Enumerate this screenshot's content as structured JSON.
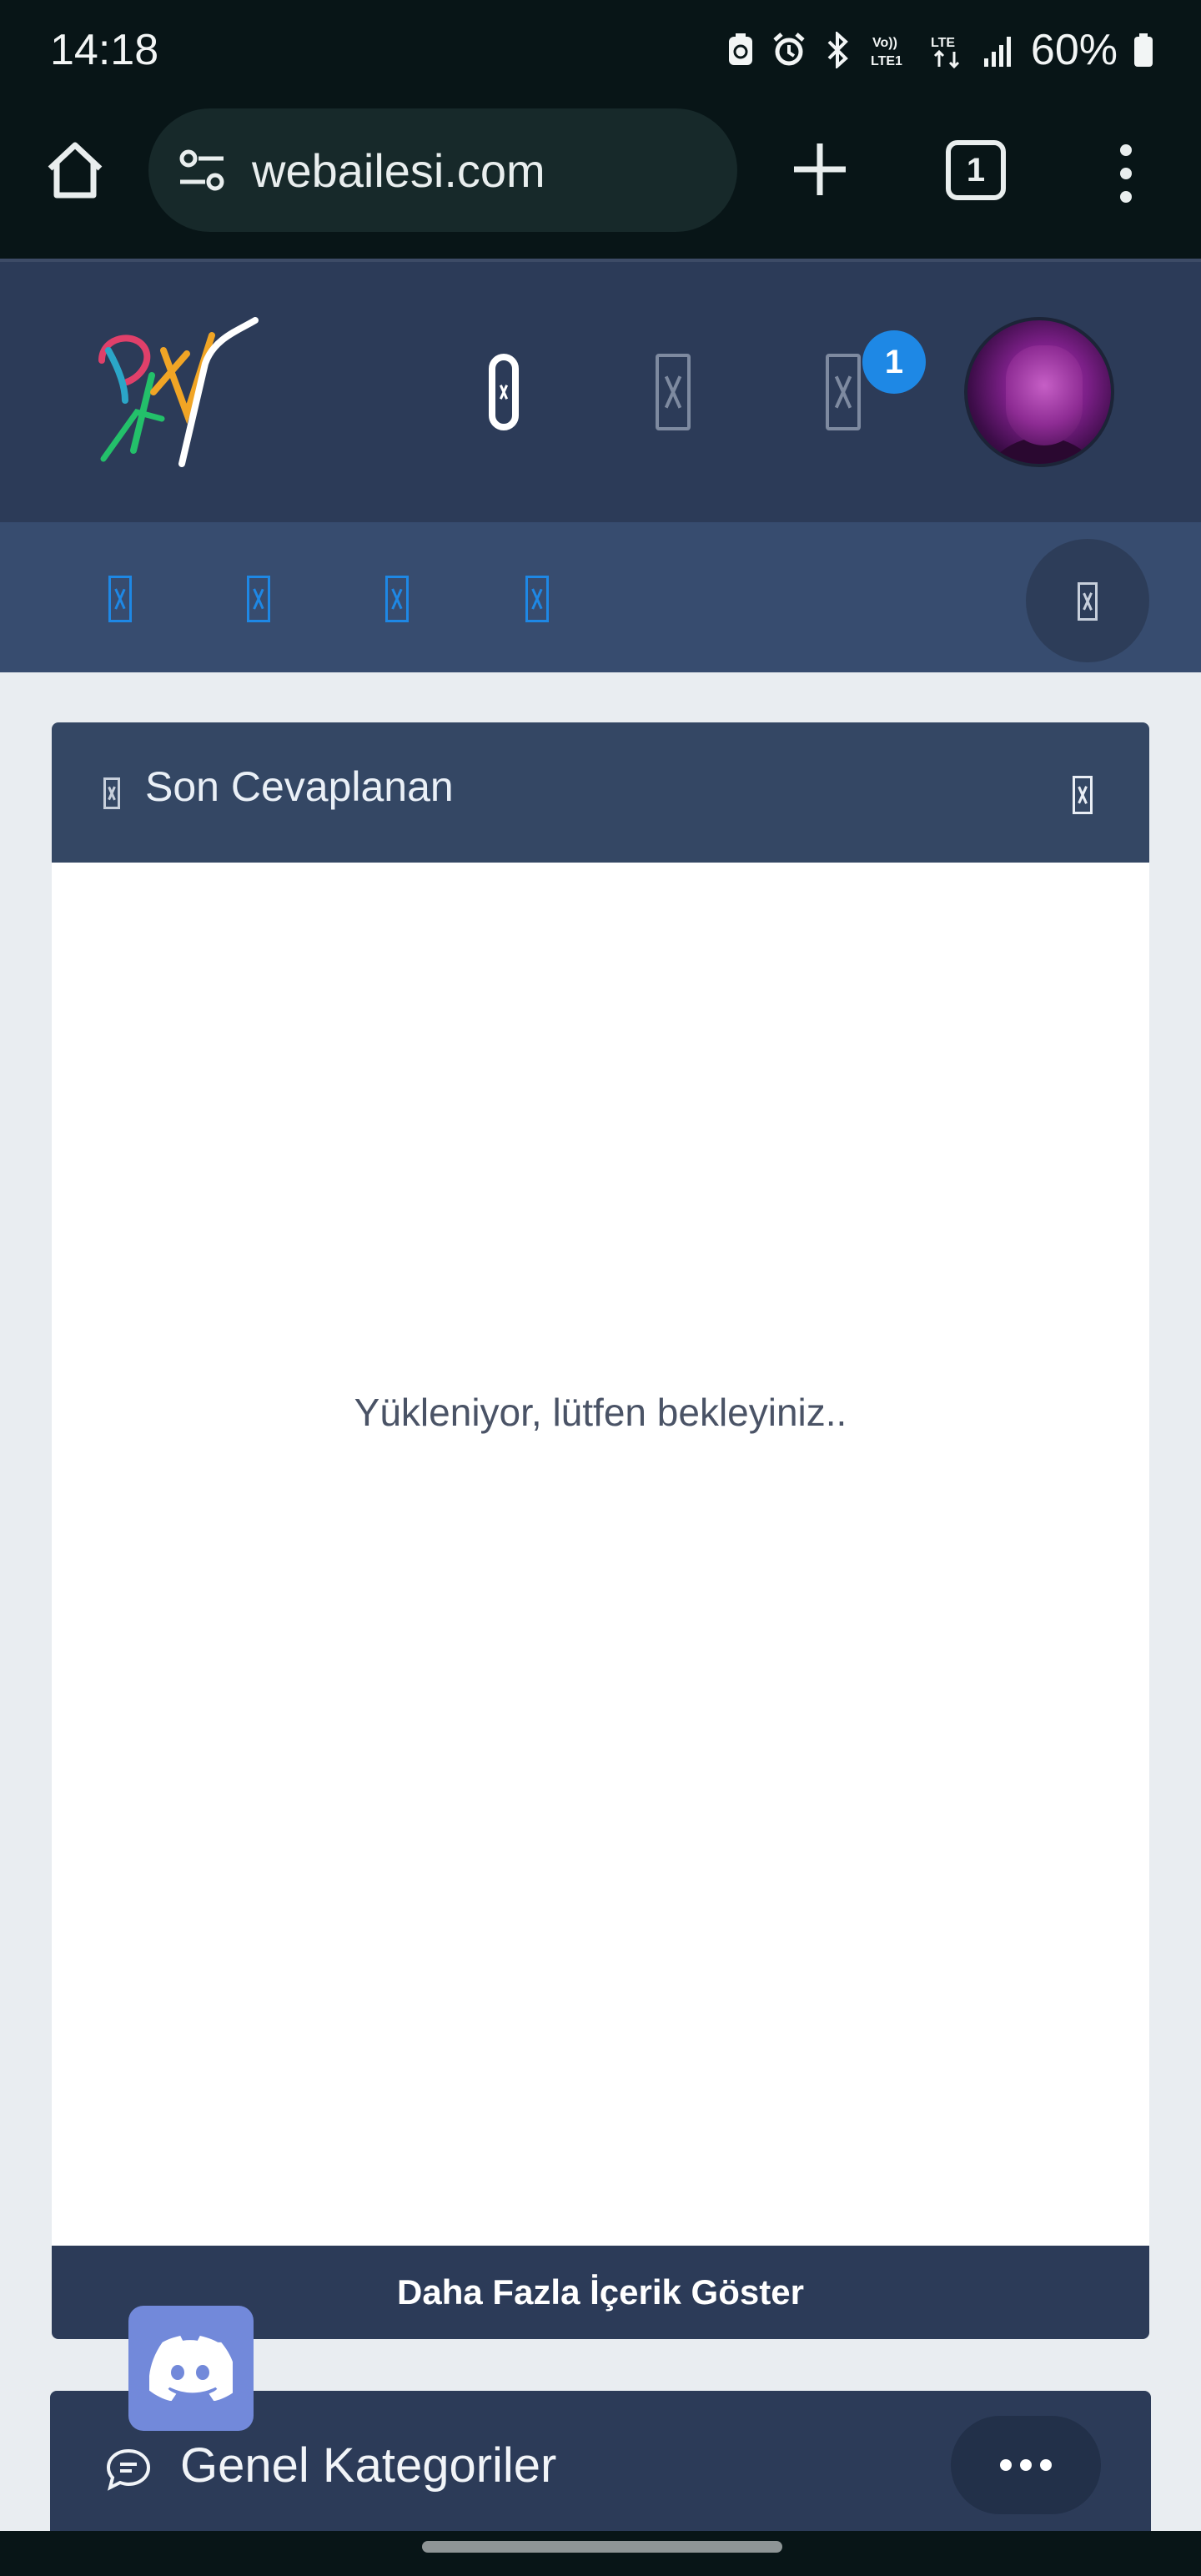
{
  "status_bar": {
    "time": "14:18",
    "icons": [
      "recycle-icon",
      "alarm-icon",
      "bluetooth-icon",
      "volte-lte1-icon",
      "lte-icon",
      "signal-icon"
    ],
    "battery_percent": "60%"
  },
  "browser": {
    "url": "webailesi.com",
    "tab_count": "1"
  },
  "header": {
    "notification_count": "1"
  },
  "widget": {
    "title": "Son Cevaplanan",
    "loading_text": "Yükleniyor, lütfen bekleyiniz..",
    "more_button_label": "Daha Fazla İçerik Göster"
  },
  "categories": {
    "title": "Genel Kategoriler"
  },
  "colors": {
    "header_bg": "#2c3b58",
    "nav_bg": "#374c6f",
    "badge": "#1e88e5",
    "discord": "#7289da"
  }
}
